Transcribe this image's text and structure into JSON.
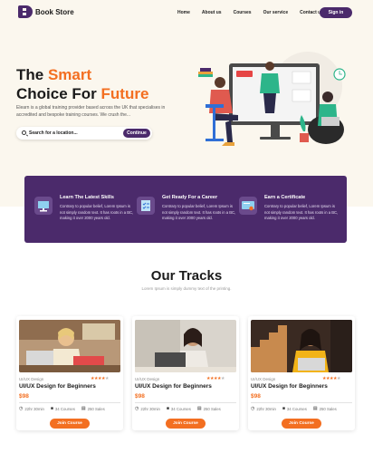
{
  "brand": {
    "name": "Book Store",
    "accent": "#f36f21",
    "primary": "#4b2a6b"
  },
  "nav": {
    "items": [
      "Home",
      "About us",
      "Courses",
      "Our service",
      "Contact us"
    ],
    "signin_label": "Sign in"
  },
  "hero": {
    "title_line1_a": "The ",
    "title_line1_b": "Smart",
    "title_line2_a": "Choice For ",
    "title_line2_b": "Future",
    "description": "Elearn is a global training provider based across the UK that specialises in accredited and bespoke training courses. We crush the...",
    "search_placeholder": "Search for a location...",
    "continue_label": "Continue"
  },
  "features": [
    {
      "title": "Learn The Latest Skills",
      "text": "Contrary to popular belief, Lorem Ipsum is not simply random text. It has roots in a BC, making it over 2000 years old.",
      "icon": "whiteboard-icon"
    },
    {
      "title": "Get Ready For a Career",
      "text": "Contrary to popular belief, Lorem Ipsum is not simply random text. It has roots in a BC, making it over 2000 years old.",
      "icon": "checklist-icon"
    },
    {
      "title": "Earn a Certificate",
      "text": "Contrary to popular belief, Lorem Ipsum is not simply random text. It has roots in a BC, making it over 2000 years old.",
      "icon": "certificate-icon"
    }
  ],
  "tracks": {
    "title": "Our Tracks",
    "subtitle": "Lorem Ipsum is simply dummy text of the printing.",
    "cards": [
      {
        "category": "UI/UX Design",
        "rating": 4,
        "title": "UI/UX Design for Beginners",
        "price": "$98",
        "duration": "22hr 30min",
        "courses": "34 Courses",
        "sales": "250 Sales",
        "join_label": "Join Course"
      },
      {
        "category": "UI/UX Design",
        "rating": 4,
        "title": "UI/UX Design for Beginners",
        "price": "$98",
        "duration": "22hr 30min",
        "courses": "34 Courses",
        "sales": "250 Sales",
        "join_label": "Join Course"
      },
      {
        "category": "UI/UX Design",
        "rating": 4,
        "title": "UI/UX Design for Beginners",
        "price": "$98",
        "duration": "22hr 30min",
        "courses": "34 Courses",
        "sales": "250 Sales",
        "join_label": "Join Course"
      }
    ]
  }
}
